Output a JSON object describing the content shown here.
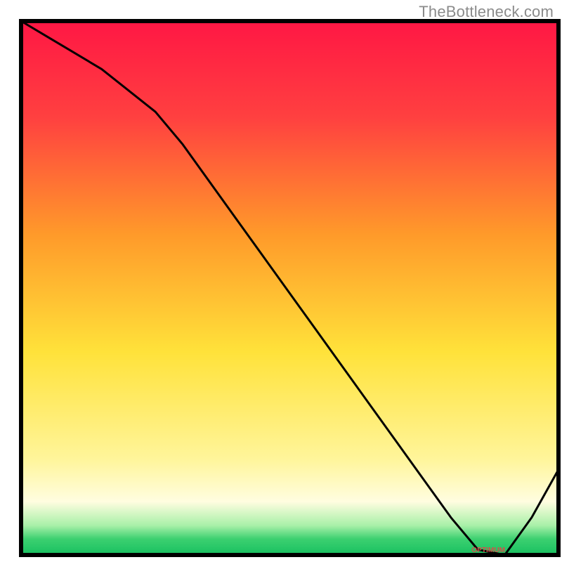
{
  "attribution": "TheBottleneck.com",
  "marker_label": "OPTIMUM",
  "chart_data": {
    "type": "line",
    "title": "",
    "xlabel": "",
    "ylabel": "",
    "xlim": [
      0,
      100
    ],
    "ylim": [
      0,
      100
    ],
    "x": [
      0,
      5,
      10,
      15,
      20,
      25,
      30,
      35,
      40,
      45,
      50,
      55,
      60,
      65,
      70,
      75,
      80,
      85,
      90,
      95,
      100
    ],
    "y": [
      100,
      97,
      94,
      91,
      87,
      83,
      77,
      70,
      63,
      56,
      49,
      42,
      35,
      28,
      21,
      14,
      7,
      1,
      0,
      7,
      16
    ],
    "gradient_stops": [
      {
        "offset": 0.0,
        "color": "#ff1744"
      },
      {
        "offset": 0.18,
        "color": "#ff4040"
      },
      {
        "offset": 0.4,
        "color": "#ff9a2a"
      },
      {
        "offset": 0.62,
        "color": "#ffe23a"
      },
      {
        "offset": 0.82,
        "color": "#fff59a"
      },
      {
        "offset": 0.9,
        "color": "#fffde0"
      },
      {
        "offset": 0.945,
        "color": "#a8f0a8"
      },
      {
        "offset": 0.97,
        "color": "#3cd070"
      },
      {
        "offset": 1.0,
        "color": "#18c060"
      }
    ],
    "minimum_pos_pct": 88
  }
}
